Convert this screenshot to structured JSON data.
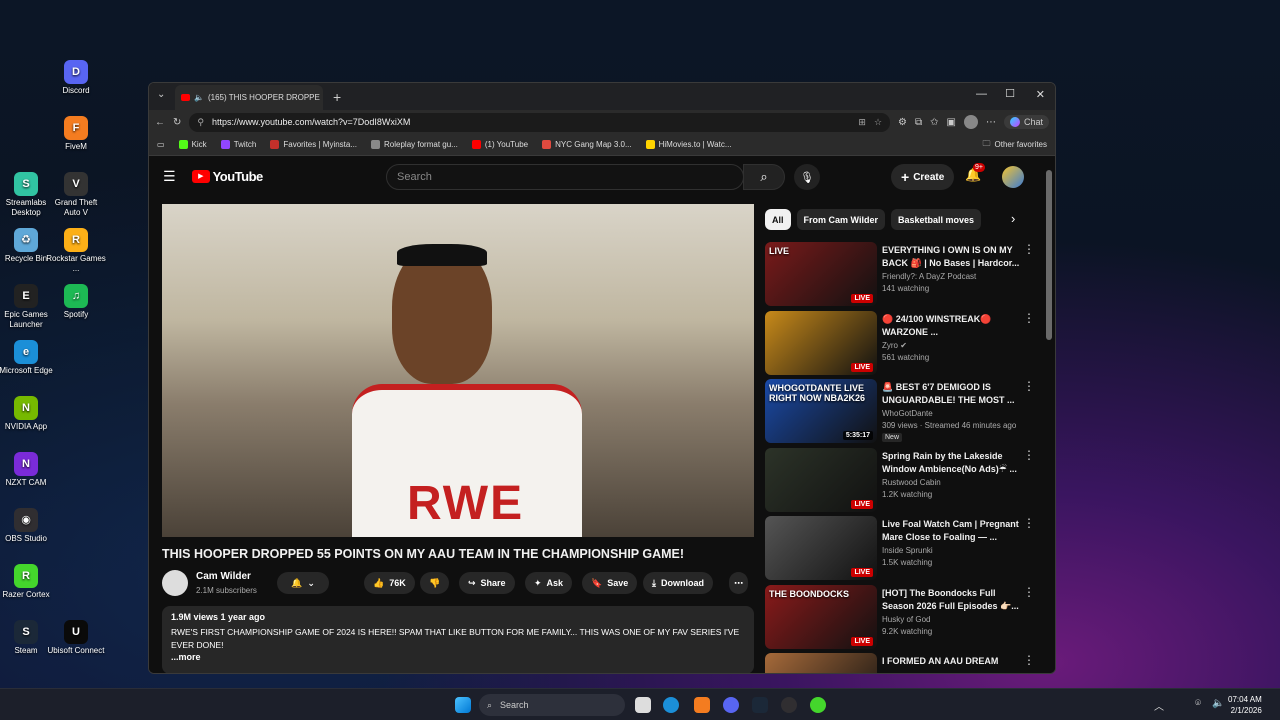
{
  "desktop": {
    "icons": [
      {
        "label": "Discord",
        "color": "#5865f2",
        "glyph": "D"
      },
      {
        "label": "FiveM",
        "color": "#f47c20",
        "glyph": "F"
      },
      {
        "label": "Streamlabs Desktop",
        "color": "#31c3a2",
        "glyph": "S"
      },
      {
        "label": "Grand Theft Auto V",
        "color": "#333",
        "glyph": "V"
      },
      {
        "label": "Recycle Bin",
        "color": "#5fa8d8",
        "glyph": "♻"
      },
      {
        "label": "Rockstar Games ...",
        "color": "#fcaf17",
        "glyph": "R"
      },
      {
        "label": "Epic Games Launcher",
        "color": "#222",
        "glyph": "E"
      },
      {
        "label": "Spotify",
        "color": "#1db954",
        "glyph": "♫"
      },
      {
        "label": "Microsoft Edge",
        "color": "#1b8fd8",
        "glyph": "e"
      },
      {
        "label": "NVIDIA App",
        "color": "#76b900",
        "glyph": "N"
      },
      {
        "label": "NZXT CAM",
        "color": "#7a2bd8",
        "glyph": "N"
      },
      {
        "label": "OBS Studio",
        "color": "#302e31",
        "glyph": "◉"
      },
      {
        "label": "Razer Cortex",
        "color": "#44d62c",
        "glyph": "R"
      },
      {
        "label": "Ubisoft Connect",
        "color": "#0a0a0a",
        "glyph": "U"
      },
      {
        "label": "Steam",
        "color": "#1b2838",
        "glyph": "S"
      }
    ]
  },
  "browser": {
    "tab_title": "(165) THIS HOOPER DROPPE",
    "url": "https://www.youtube.com/watch?v=7DodI8WxiXM",
    "chat_label": "Chat",
    "favorites": [
      "Kick",
      "Twitch",
      "Favorites | Myinsta...",
      "Roleplay format gu...",
      "(1) YouTube",
      "NYC Gang Map 3.0...",
      "HiMovies.to | Watc..."
    ],
    "other_favorites": "Other favorites"
  },
  "youtube": {
    "logo": "YouTube",
    "search_placeholder": "Search",
    "create_label": "Create",
    "notif_badge": "9+",
    "video_title": "THIS HOOPER DROPPED 55 POINTS ON MY AAU TEAM IN THE CHAMPIONSHIP GAME!",
    "jersey_text": "RWE",
    "channel": "Cam Wilder",
    "subscribers": "2.1M subscribers",
    "likes": "76K",
    "share": "Share",
    "ask": "Ask",
    "save": "Save",
    "download": "Download",
    "desc_meta": "1.9M views  1 year ago",
    "desc_text": "RWE'S FIRST CHAMPIONSHIP GAME OF 2024 IS HERE!! SPAM THAT LIKE BUTTON FOR ME FAMILY... THIS WAS ONE OF MY FAV SERIES I'VE EVER DONE!",
    "more": "...more",
    "chips": [
      "All",
      "From Cam Wilder",
      "Basketball moves"
    ],
    "recs": [
      {
        "title": "EVERYTHING I OWN IS ON MY BACK 🎒 | No Bases | Hardcor...",
        "channel": "Friendly?: A DayZ Podcast",
        "meta": "141 watching",
        "badge": "LIVE",
        "thumb": "#7a1a1a",
        "thumb_text": "LIVE"
      },
      {
        "title": "🔴 24/100 WINSTREAK🔴 WARZONE ...",
        "channel": "Zyro ✔",
        "meta": "561 watching",
        "badge": "LIVE",
        "thumb": "#c88a1a",
        "thumb_text": ""
      },
      {
        "title": "🚨 BEST 6'7 DEMIGOD IS UNGUARDABLE! THE MOST ...",
        "channel": "WhoGotDante",
        "meta": "309 views · Streamed 46 minutes ago",
        "badge": "5:35:17",
        "thumb": "#1a4aa8",
        "thumb_text": "WHOGOTDANTE LIVE RIGHT NOW NBA2K26",
        "new": "New"
      },
      {
        "title": "Spring Rain by the Lakeside Window Ambience(No Ads)☔ ...",
        "channel": "Rustwood Cabin",
        "meta": "1.2K watching",
        "badge": "LIVE",
        "thumb": "#2c3328",
        "thumb_text": ""
      },
      {
        "title": "Live Foal Watch Cam | Pregnant Mare Close to Foaling — ...",
        "channel": "Inside Sprunki",
        "meta": "1.5K watching",
        "badge": "LIVE",
        "thumb": "#555",
        "thumb_text": ""
      },
      {
        "title": "[HOT] The Boondocks Full Season 2026 Full Episodes 👉🏻...",
        "channel": "Husky of God",
        "meta": "9.2K watching",
        "badge": "LIVE",
        "thumb": "#8a1a1a",
        "thumb_text": "THE BOONDOCKS"
      },
      {
        "title": "I FORMED AN AAU DREAM",
        "channel": "",
        "meta": "",
        "badge": "",
        "thumb": "#a66a3a",
        "thumb_text": ""
      }
    ]
  },
  "taskbar": {
    "search": "Search",
    "time": "07:04 AM",
    "date": "2/1/2026"
  }
}
